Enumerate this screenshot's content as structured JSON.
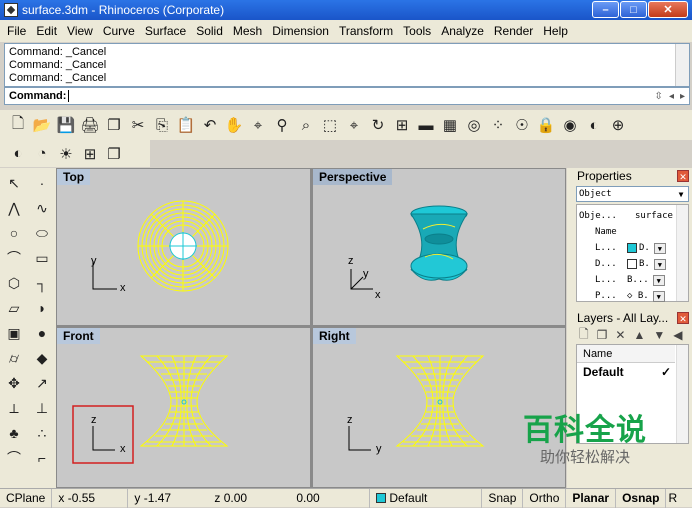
{
  "window": {
    "title": "surface.3dm - Rhinoceros (Corporate)",
    "minimize": "–",
    "maximize": "□",
    "close": "✕"
  },
  "menu": [
    "File",
    "Edit",
    "View",
    "Curve",
    "Surface",
    "Solid",
    "Mesh",
    "Dimension",
    "Transform",
    "Tools",
    "Analyze",
    "Render",
    "Help"
  ],
  "command_history": [
    "Command: _Cancel",
    "Command: _Cancel",
    "Command: _Cancel"
  ],
  "command_prompt": "Command:",
  "toolbar1_icons": [
    "new-icon",
    "open-icon",
    "save-icon",
    "print-icon",
    "import-icon",
    "cut-icon",
    "copy-icon",
    "paste-icon",
    "undo-icon",
    "pan-hand-icon",
    "rotate-view-icon",
    "zoom-icon",
    "zoom-window-icon",
    "zoom-extents-icon",
    "zoom-selected-icon",
    "undo-view-icon",
    "four-view-icon",
    "car-icon",
    "grid-icon",
    "osnap-icon",
    "point-cloud-icon",
    "light-icon",
    "lock-icon",
    "render-icon",
    "color-wheel-icon",
    "sphere-icon"
  ],
  "toolbar1_glyphs": [
    "🗋",
    "📂",
    "💾",
    "🖨",
    "❐",
    "✂",
    "⎘",
    "📋",
    "↶",
    "✋",
    "⌖",
    "⚲",
    "⌕",
    "⬚",
    "⌖",
    "↻",
    "⊞",
    "▬",
    "▦",
    "◎",
    "⁘",
    "☉",
    "🔒",
    "◉",
    "◐",
    "⊕"
  ],
  "toolbar2_icons": [
    "render-color-icon",
    "render-preview-icon",
    "sun-icon",
    "layout-icon",
    "properties-icon"
  ],
  "toolbar2_glyphs": [
    "◐",
    "◔",
    "☀",
    "⊞",
    "❐"
  ],
  "left_tools": [
    {
      "name": "select-icon",
      "g": "↖"
    },
    {
      "name": "point-icon",
      "g": "·"
    },
    {
      "name": "polyline-icon",
      "g": "⋀"
    },
    {
      "name": "curve-icon",
      "g": "∿"
    },
    {
      "name": "circle-icon",
      "g": "○"
    },
    {
      "name": "ellipse-icon",
      "g": "⬭"
    },
    {
      "name": "arc-icon",
      "g": "⌒"
    },
    {
      "name": "rectangle-icon",
      "g": "▭"
    },
    {
      "name": "polygon-icon",
      "g": "⬡"
    },
    {
      "name": "fillet-icon",
      "g": "┐"
    },
    {
      "name": "surface-icon",
      "g": "▱"
    },
    {
      "name": "loft-icon",
      "g": "◗"
    },
    {
      "name": "box-icon",
      "g": "▣"
    },
    {
      "name": "sphere-solid-icon",
      "g": "●"
    },
    {
      "name": "cylinder-icon",
      "g": "⌭"
    },
    {
      "name": "extrude-icon",
      "g": "◆"
    },
    {
      "name": "transform-icon",
      "g": "✥"
    },
    {
      "name": "gumball-icon",
      "g": "↗"
    },
    {
      "name": "analyze-icon",
      "g": "⟂"
    },
    {
      "name": "dimension-icon",
      "g": "⊥"
    },
    {
      "name": "group-icon",
      "g": "♣"
    },
    {
      "name": "array-icon",
      "g": "∴"
    },
    {
      "name": "trim-icon",
      "g": "⌒"
    },
    {
      "name": "split-icon",
      "g": "⌐"
    }
  ],
  "viewports": {
    "top": "Top",
    "perspective": "Perspective",
    "front": "Front",
    "right": "Right"
  },
  "axes": {
    "top_v": "y",
    "top_h": "x",
    "persp_z": "z",
    "persp_y": "y",
    "persp_x": "x",
    "front_v": "z",
    "front_h": "x",
    "right_v": "z",
    "right_h": "y"
  },
  "properties": {
    "title": "Properties",
    "selector": "Object",
    "header_k": "Obje...",
    "header_v": "surface",
    "rows": [
      {
        "k": "Name",
        "v": ""
      },
      {
        "k": "L...",
        "v": "D.",
        "swatch": "#1ec8d6"
      },
      {
        "k": "D...",
        "v": "B.",
        "swatch": "#ffffff"
      },
      {
        "k": "L...",
        "v": "B..."
      },
      {
        "k": "P...",
        "v": "◇ B."
      }
    ]
  },
  "layers": {
    "title": "Layers - All Lay...",
    "tools": [
      "🗋",
      "❐",
      "✕",
      "▲",
      "▼",
      "◀"
    ],
    "column": "Name",
    "rows": [
      {
        "name": "Default",
        "check": "✓"
      }
    ]
  },
  "watermark": {
    "big": "百科全说",
    "small": "助你轻松解决"
  },
  "status": {
    "cplane": "CPlane",
    "x": "x -0.55",
    "y": "y -1.47",
    "z": "z 0.00",
    "d": "0.00",
    "layer": "Default",
    "snap": "Snap",
    "ortho": "Ortho",
    "planar": "Planar",
    "osnap": "Osnap",
    "record": "R"
  },
  "colors": {
    "surface_wire": "#ffff00",
    "surface_shaded": "#1ec8d6",
    "viewport_bg": "#c8c8c8",
    "title_bar": "#2b74e6",
    "highlight_box": "#d22020"
  }
}
